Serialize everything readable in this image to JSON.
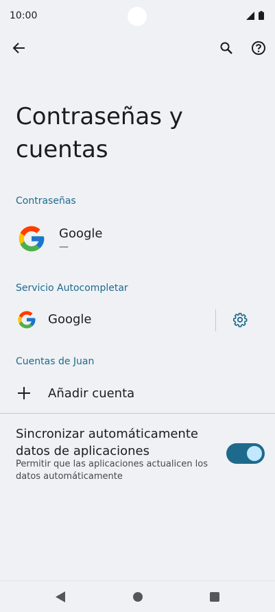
{
  "status_bar": {
    "time": "10:00"
  },
  "page": {
    "title": "Contraseñas y cuentas"
  },
  "passwords_section": {
    "header": "Contraseñas",
    "item": {
      "title": "Google",
      "subtitle": "—"
    }
  },
  "autofill_section": {
    "header": "Servicio Autocompletar",
    "item": {
      "title": "Google"
    }
  },
  "accounts_section": {
    "header": "Cuentas de Juan",
    "add_label": "Añadir cuenta"
  },
  "sync": {
    "title": "Sincronizar automáticamente datos de aplicaciones",
    "description": "Permitir que las aplicaciones actualicen los datos automáticamente",
    "enabled": true
  },
  "colors": {
    "accent": "#1e6a8c",
    "background": "#eff1f5",
    "toggle_knob": "#c2e8ff"
  },
  "icons": [
    "back-arrow-icon",
    "search-icon",
    "help-icon",
    "google-logo-icon",
    "gear-icon",
    "plus-icon",
    "nav-back-icon",
    "nav-home-icon",
    "nav-recents-icon"
  ]
}
